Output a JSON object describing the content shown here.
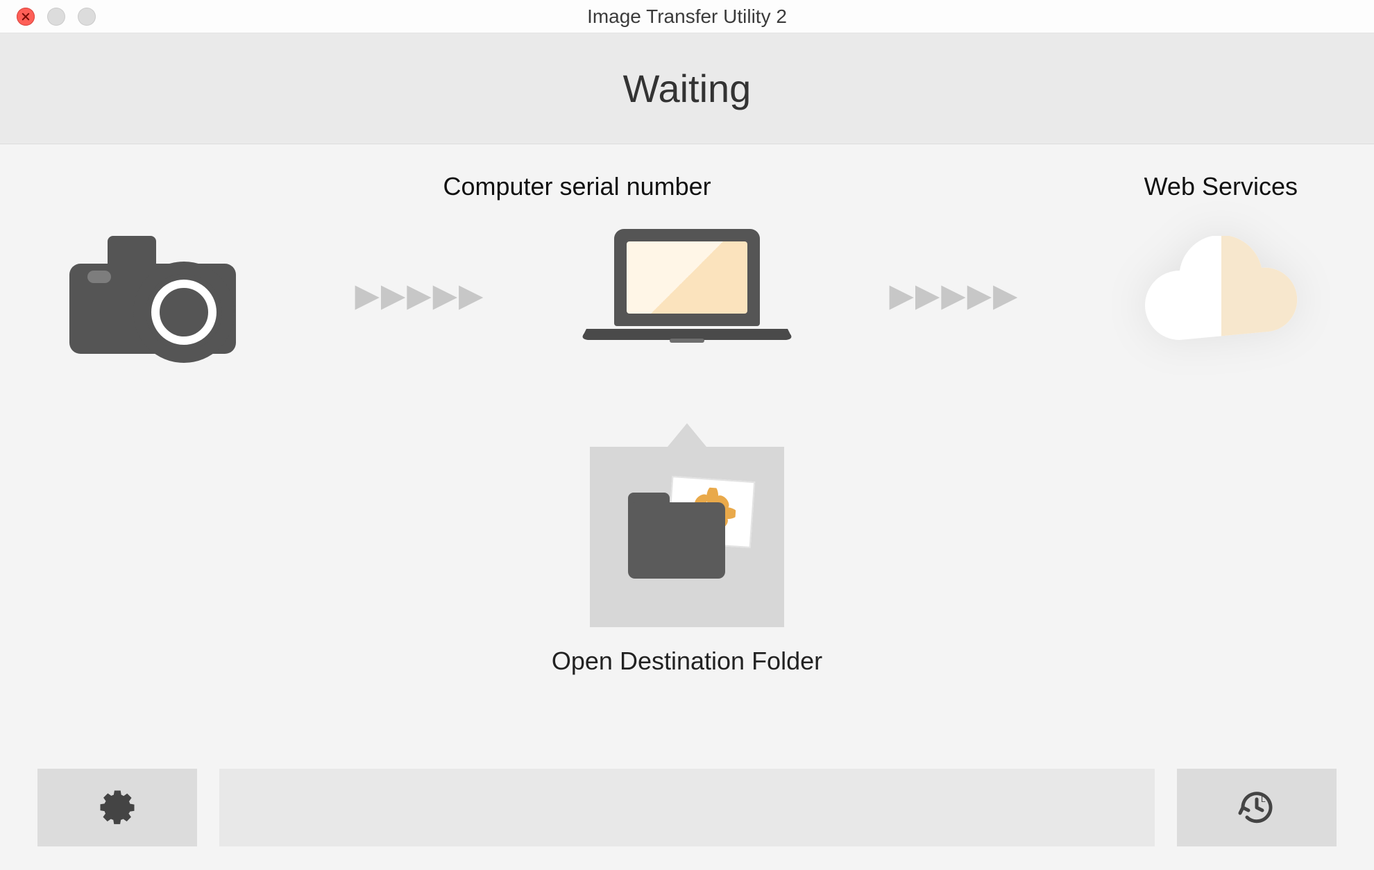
{
  "window": {
    "title": "Image Transfer Utility 2"
  },
  "status": {
    "text": "Waiting"
  },
  "labels": {
    "computer": "Computer serial number",
    "web_services": "Web Services"
  },
  "destination": {
    "button_label": "Open Destination Folder"
  }
}
